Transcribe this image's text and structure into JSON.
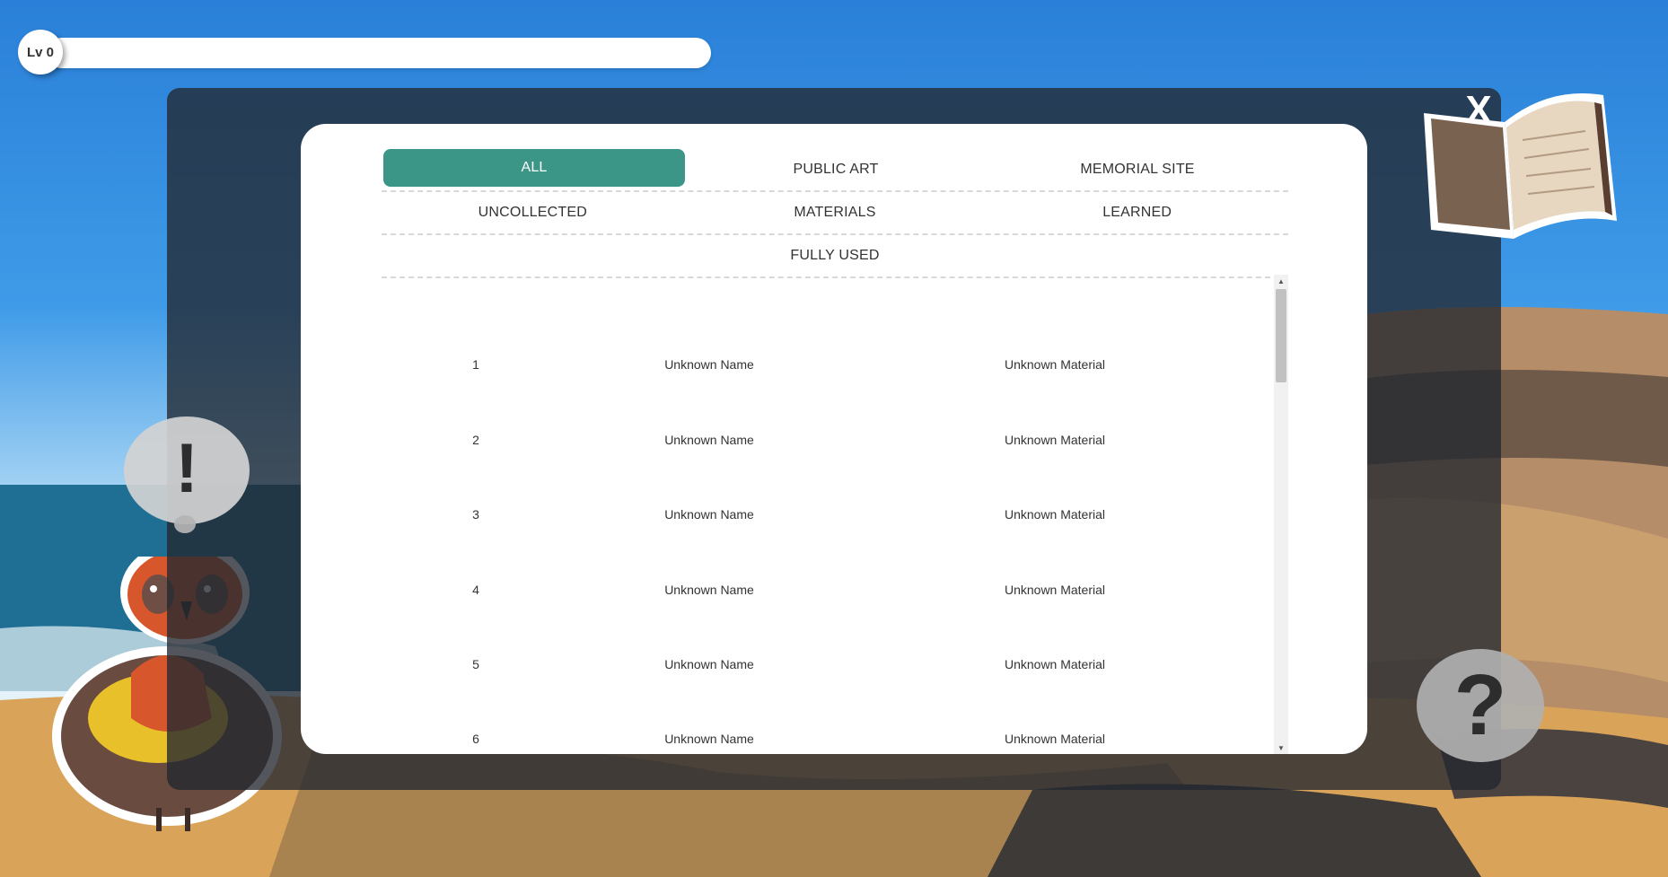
{
  "hud": {
    "level_label": "Lv 0",
    "level_progress": 0
  },
  "dialog": {
    "close_label": "X",
    "tabs": [
      [
        {
          "label": "ALL",
          "active": true
        },
        {
          "label": "PUBLIC ART"
        },
        {
          "label": "MEMORIAL SITE"
        }
      ],
      [
        {
          "label": "UNCOLLECTED"
        },
        {
          "label": "MATERIALS"
        },
        {
          "label": "LEARNED"
        }
      ],
      [
        {
          "label": "FULLY USED"
        }
      ]
    ],
    "rows": [
      {
        "num": "1",
        "name": "Unknown Name",
        "material": "Unknown Material"
      },
      {
        "num": "2",
        "name": "Unknown Name",
        "material": "Unknown Material"
      },
      {
        "num": "3",
        "name": "Unknown Name",
        "material": "Unknown Material"
      },
      {
        "num": "4",
        "name": "Unknown Name",
        "material": "Unknown Material"
      },
      {
        "num": "5",
        "name": "Unknown Name",
        "material": "Unknown Material"
      },
      {
        "num": "6",
        "name": "Unknown Name",
        "material": "Unknown Material"
      }
    ]
  },
  "hints": {
    "alert_glyph": "!",
    "help_glyph": "?"
  },
  "icons": {
    "book": "open-book-icon",
    "alert": "exclamation-icon",
    "help": "question-mark-icon",
    "mascot": "bird-mascot"
  },
  "colors": {
    "accent": "#3b9688",
    "sky_top": "#2a7fd6",
    "sand": "#d9a45a"
  }
}
